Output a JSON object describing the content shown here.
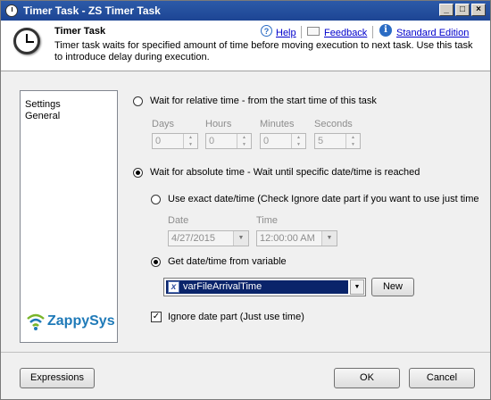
{
  "window": {
    "title": "Timer Task - ZS Timer Task"
  },
  "header": {
    "title": "Timer Task",
    "description": "Timer task waits for specified amount of time before moving execution to next task. Use this task to introduce delay during execution.",
    "links": {
      "help": "Help",
      "feedback": "Feedback",
      "edition": "Standard Edition"
    }
  },
  "sidebar": {
    "items": [
      {
        "label": "Settings"
      },
      {
        "label": "General"
      }
    ],
    "logo_text": "ZappySys"
  },
  "relative": {
    "label": "Wait for relative time - from the start time of this task",
    "fields": [
      {
        "label": "Days",
        "value": "0"
      },
      {
        "label": "Hours",
        "value": "0"
      },
      {
        "label": "Minutes",
        "value": "0"
      },
      {
        "label": "Seconds",
        "value": "5"
      }
    ]
  },
  "absolute": {
    "label": "Wait for absolute time - Wait until specific date/time is reached",
    "exact": {
      "label": "Use exact date/time (Check Ignore date part if you want to use just time",
      "date_label": "Date",
      "date_value": "4/27/2015",
      "time_label": "Time",
      "time_value": "12:00:00 AM"
    },
    "variable": {
      "label": "Get date/time from variable",
      "value": "varFileArrivalTime",
      "new_button": "New"
    },
    "ignore_date": {
      "label": "Ignore date part (Just use time)",
      "checked": true
    }
  },
  "footer": {
    "expressions": "Expressions",
    "ok": "OK",
    "cancel": "Cancel"
  },
  "colors": {
    "titlebar": "#1d4594",
    "selection": "#0a246a",
    "link": "#0000cc"
  }
}
